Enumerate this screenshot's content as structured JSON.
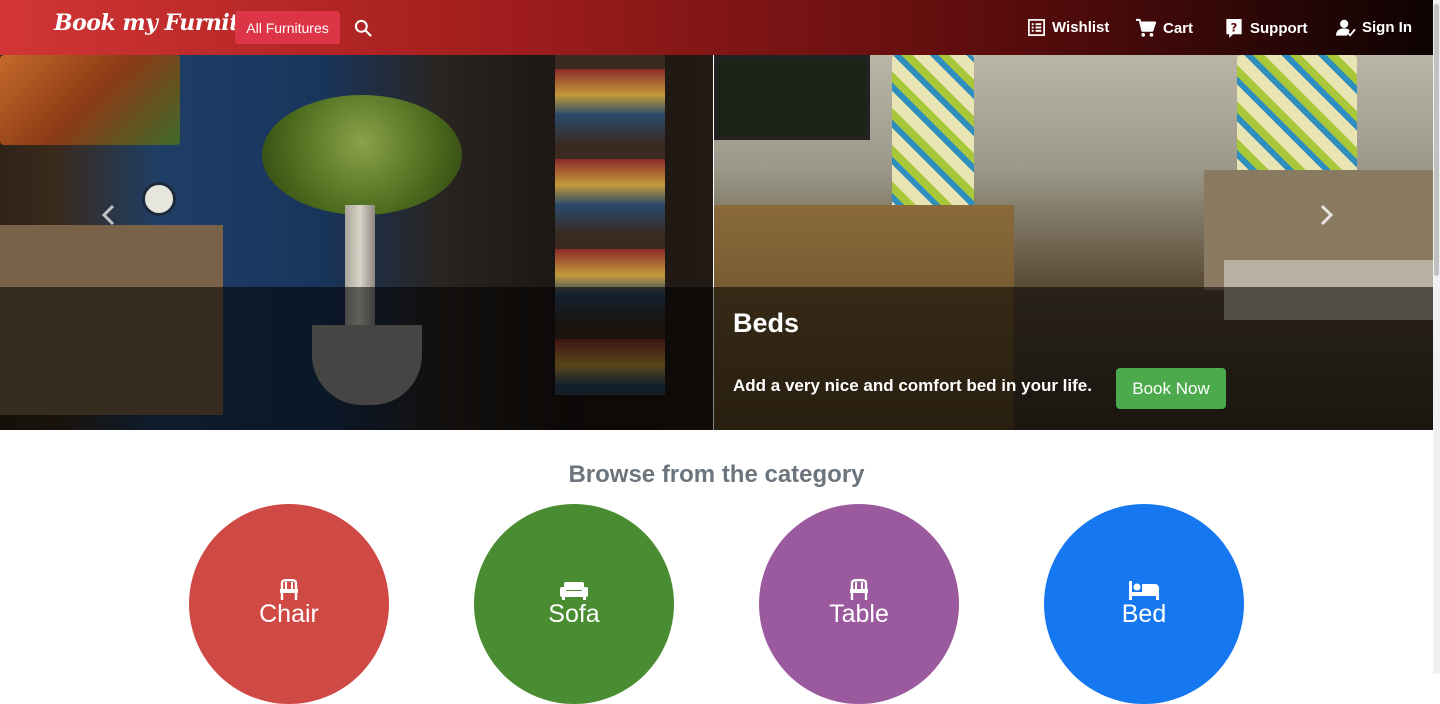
{
  "navbar": {
    "brand": "Book my Furniture",
    "all_furnitures": "All Furnitures",
    "wishlist": "Wishlist",
    "cart": "Cart",
    "support": "Support",
    "sign_in": "Sign In"
  },
  "carousel": {
    "caption_title": "Beds",
    "caption_text": "Add a very nice and comfort bed in your life.",
    "button": "Book Now"
  },
  "categories": {
    "heading": "Browse from the category",
    "items": [
      {
        "label": "Chair",
        "color": "#cf4a44",
        "icon": "chair-icon"
      },
      {
        "label": "Sofa",
        "color": "#4a8c32",
        "icon": "sofa-icon"
      },
      {
        "label": "Table",
        "color": "#9b5a9e",
        "icon": "table-icon"
      },
      {
        "label": "Bed",
        "color": "#1678f0",
        "icon": "bed-icon"
      }
    ]
  },
  "colors": {
    "primary_red": "#dc3545",
    "book_now_green": "#4caa4c"
  }
}
